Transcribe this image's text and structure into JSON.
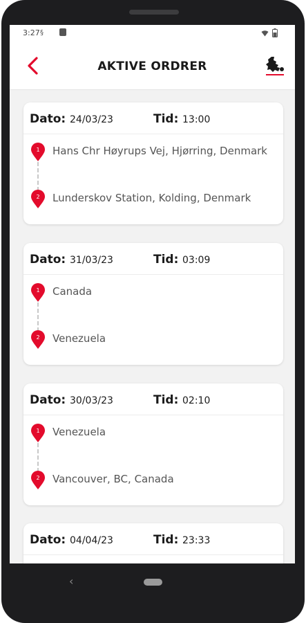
{
  "status_bar": {
    "time": "3:27"
  },
  "app_bar": {
    "title": "AKTIVE ORDRER"
  },
  "labels": {
    "dato": "Dato:",
    "tid": "Tid:"
  },
  "orders": [
    {
      "date": "24/03/23",
      "time": "13:00",
      "from_num": "1",
      "from": "Hans Chr Høyrups Vej, Hjørring, Denmark",
      "to_num": "2",
      "to": "Lunderskov Station, Kolding, Denmark"
    },
    {
      "date": "31/03/23",
      "time": "03:09",
      "from_num": "1",
      "from": "Canada",
      "to_num": "2",
      "to": "Venezuela"
    },
    {
      "date": "30/03/23",
      "time": "02:10",
      "from_num": "1",
      "from": "Venezuela",
      "to_num": "2",
      "to": "Vancouver, BC, Canada"
    },
    {
      "date": "04/04/23",
      "time": "23:33"
    }
  ],
  "nav": {
    "back_glyph": "‹"
  },
  "colors": {
    "accent": "#e30b2c",
    "background": "#f2f2f2",
    "card": "#ffffff"
  },
  "icons": [
    "back-arrow-icon",
    "logo-icon",
    "location-pin-icon"
  ]
}
